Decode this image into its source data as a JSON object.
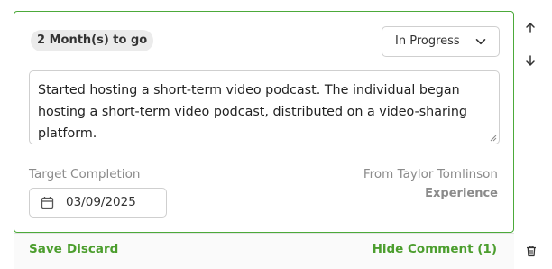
{
  "goal_card": {
    "time_remaining": "2 Month(s) to go",
    "status": {
      "selected": "In Progress"
    },
    "description": "Started hosting a short-term video podcast. The individual began hosting a short-term video podcast, distributed on a video-sharing platform.",
    "target_completion": {
      "label": "Target Completion",
      "date": "03/09/2025"
    },
    "source": {
      "from_text": "From Taylor Tomlinson",
      "type": "Experience"
    },
    "actions": {
      "save": "Save",
      "discard": "Discard",
      "toggle_comments": "Hide Comment (1)"
    }
  },
  "colors": {
    "accent": "#4caa3a",
    "link": "#4c9e2e",
    "muted_text": "#8b8b8b",
    "badge_bg": "#ebebeb"
  },
  "icons": [
    "chevron-down-icon",
    "calendar-icon",
    "arrow-up-icon",
    "arrow-down-icon",
    "trash-icon"
  ]
}
